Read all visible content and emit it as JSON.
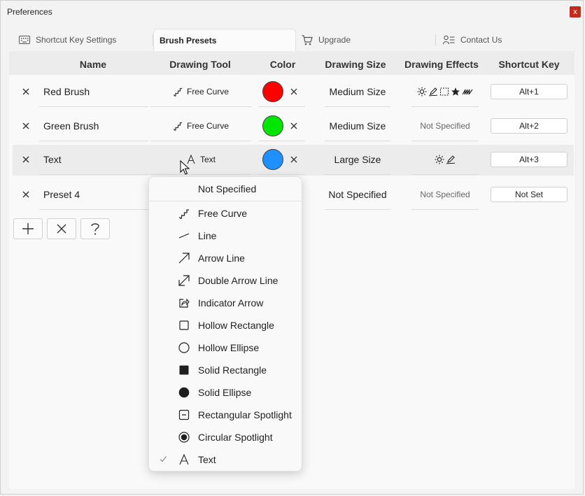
{
  "window": {
    "title": "Preferences",
    "close_label": "x"
  },
  "tabs": [
    {
      "label": "Shortcut Key Settings",
      "icon": "keyboard-icon",
      "active": false
    },
    {
      "label": "Brush Presets",
      "icon": "",
      "active": true
    },
    {
      "label": "Upgrade",
      "icon": "cart-icon",
      "active": false
    },
    {
      "label": "Contact Us",
      "icon": "contact-icon",
      "active": false
    }
  ],
  "table": {
    "headers": [
      "Name",
      "Drawing Tool",
      "Color",
      "Drawing Size",
      "Drawing Effects",
      "Shortcut Key"
    ],
    "rows": [
      {
        "name": "Red Brush",
        "tool": "Free Curve",
        "tool_icon": "free-curve-icon",
        "color": "#ff0000",
        "size": "Medium Size",
        "effects": [
          "brightness-icon",
          "pen-icon",
          "dashed-rect-icon",
          "star-icon",
          "scribble-icon"
        ],
        "effects_text": "",
        "shortcut": "Alt+1"
      },
      {
        "name": "Green Brush",
        "tool": "Free Curve",
        "tool_icon": "free-curve-icon",
        "color": "#00e600",
        "size": "Medium Size",
        "effects": [],
        "effects_text": "Not Specified",
        "shortcut": "Alt+2"
      },
      {
        "name": "Text",
        "tool": "Text",
        "tool_icon": "text-icon",
        "color": "#1e90ff",
        "size": "Large Size",
        "effects": [
          "brightness-icon",
          "pen-icon"
        ],
        "effects_text": "",
        "shortcut": "Alt+3"
      },
      {
        "name": "Preset 4",
        "tool": "",
        "tool_icon": "",
        "color": "",
        "size": "Not Specified",
        "effects": [],
        "effects_text": "Not Specified",
        "shortcut": "Not Set"
      }
    ]
  },
  "actions": [
    {
      "name": "add-preset-button",
      "icon": "plus-icon"
    },
    {
      "name": "delete-preset-button",
      "icon": "close-icon"
    },
    {
      "name": "help-button",
      "icon": "question-icon"
    }
  ],
  "dropdown": {
    "header": "Not Specified",
    "items": [
      {
        "label": "Free Curve",
        "icon": "free-curve-icon",
        "checked": false
      },
      {
        "label": "Line",
        "icon": "line-icon",
        "checked": false
      },
      {
        "label": "Arrow Line",
        "icon": "arrow-line-icon",
        "checked": false
      },
      {
        "label": "Double Arrow Line",
        "icon": "double-arrow-icon",
        "checked": false
      },
      {
        "label": "Indicator Arrow",
        "icon": "indicator-arrow-icon",
        "checked": false
      },
      {
        "label": "Hollow Rectangle",
        "icon": "hollow-rect-icon",
        "checked": false
      },
      {
        "label": "Hollow Ellipse",
        "icon": "hollow-ellipse-icon",
        "checked": false
      },
      {
        "label": "Solid Rectangle",
        "icon": "solid-rect-icon",
        "checked": false
      },
      {
        "label": "Solid Ellipse",
        "icon": "solid-ellipse-icon",
        "checked": false
      },
      {
        "label": "Rectangular Spotlight",
        "icon": "rect-spotlight-icon",
        "checked": false
      },
      {
        "label": "Circular Spotlight",
        "icon": "circle-spotlight-icon",
        "checked": false
      },
      {
        "label": "Text",
        "icon": "text-icon",
        "checked": true
      }
    ]
  }
}
